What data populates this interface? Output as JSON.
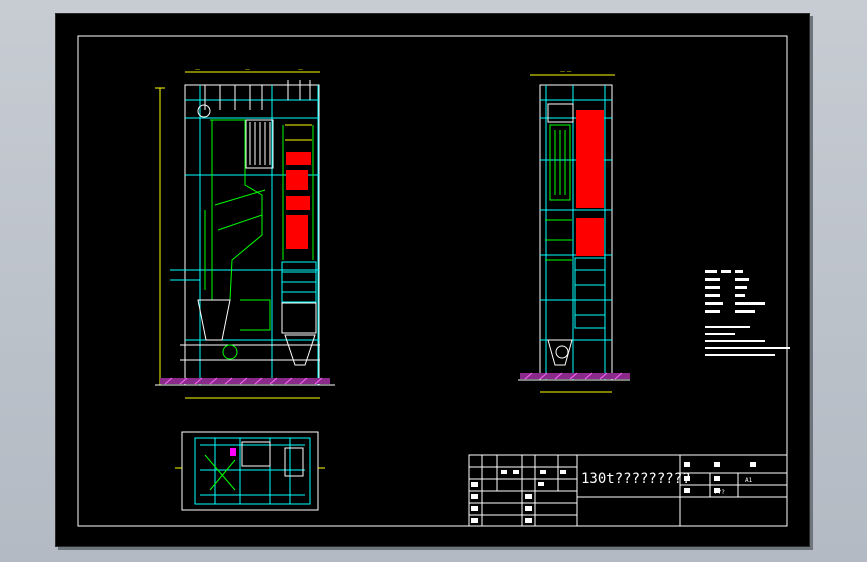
{
  "drawing": {
    "title": "130t?????????",
    "title_block_code": "???",
    "sheet_size_label": "A1"
  },
  "colors": {
    "background": "#000000",
    "frame": "#ffffff",
    "structure": "#ffffff",
    "steel": "#00ffff",
    "piping": "#00ff00",
    "heating_surface": "#ff0000",
    "foundation": "#ff00ff",
    "dimension": "#ffff00"
  }
}
